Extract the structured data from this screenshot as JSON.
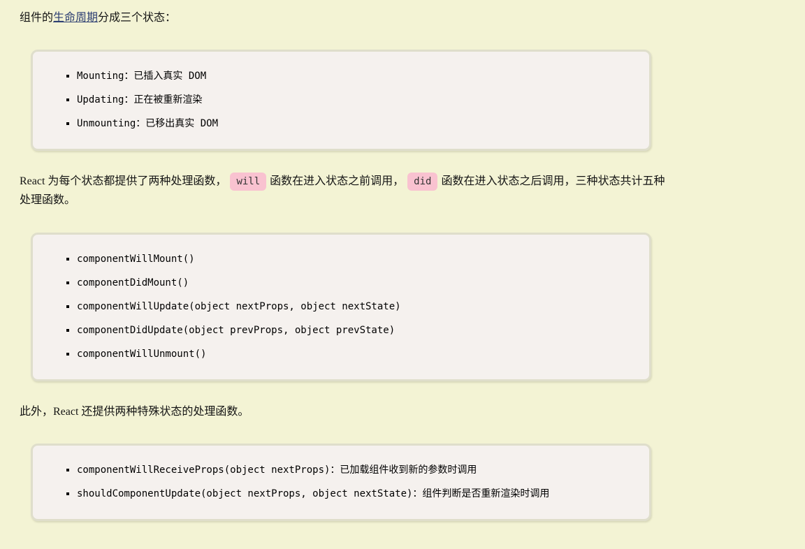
{
  "colors": {
    "page_background": "#f3f3d4",
    "box_background": "#f5f1ee",
    "box_border": "#dfdecb",
    "inline_code_background": "#f9c2d0",
    "inline_code_text": "#333333",
    "link": "#2c3e72",
    "body_text": "#141414"
  },
  "content": {
    "intro": {
      "before_link": "组件的",
      "link_text": "生命周期",
      "after_link": "分成三个状态："
    },
    "states_list": [
      "Mounting：已插入真实 DOM",
      "Updating：正在被重新渲染",
      "Unmounting：已移出真实 DOM"
    ],
    "handlers_paragraph": {
      "part1": "React 为每个状态都提供了两种处理函数，",
      "code1": "will",
      "part2": "函数在进入状态之前调用，",
      "code2": "did",
      "part3": "函数在进入状态之后调用，三种状态共计五种处理函数。"
    },
    "lifecycle_methods": [
      "componentWillMount()",
      "componentDidMount()",
      "componentWillUpdate(object nextProps, object nextState)",
      "componentDidUpdate(object prevProps, object prevState)",
      "componentWillUnmount()"
    ],
    "special_intro": "此外，React 还提供两种特殊状态的处理函数。",
    "special_methods": [
      "componentWillReceiveProps(object nextProps)：已加载组件收到新的参数时调用",
      "shouldComponentUpdate(object nextProps, object nextState)：组件判断是否重新渲染时调用"
    ]
  }
}
